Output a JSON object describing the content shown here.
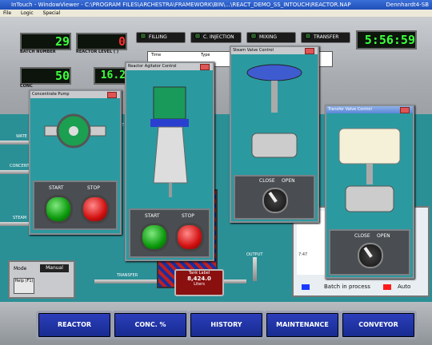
{
  "window": {
    "title": "InTouch - WindowViewer - C:\\PROGRAM FILES\\ARCHESTRA\\FRAMEWORK\\BIN\\...\\REACT_DEMO_SS_INTOUCH\\REACTOR.NAP",
    "right_text": "Dennhardt4-SB"
  },
  "menu": [
    "File",
    "Logic",
    "Special"
  ],
  "displays": {
    "batch_number": {
      "value": "29",
      "label": "BATCH NUMBER"
    },
    "reactor_level": {
      "value": "0",
      "label": "REACTOR LEVEL ( )"
    },
    "conc": {
      "value": "50",
      "label": "CONC"
    },
    "second": {
      "value": "16.2",
      "label": ""
    },
    "clock": "5:56:59"
  },
  "indicators": [
    "FILLING",
    "C. INJECTION",
    "MIXING",
    "TRANSFER"
  ],
  "alarm_headers": [
    "Time",
    "Type"
  ],
  "popups": {
    "concentrate_pump": {
      "title": "Concentrate Pump",
      "start": "START",
      "stop": "STOP"
    },
    "reactor_agitator": {
      "title": "Reactor Agitator Control",
      "start": "START",
      "stop": "STOP"
    },
    "steam_valve": {
      "title": "Steam Valve Control",
      "close": "CLOSE",
      "open": "OPEN"
    },
    "transfer_valve": {
      "title": "Transfer Valve Control",
      "close": "CLOSE",
      "open": "OPEN"
    }
  },
  "process": {
    "water_label": "WATE",
    "concent_label": "CONCENT",
    "steam_label": "STEAM",
    "act_label": "ACT",
    "transfer_label": "TRANSFER",
    "output_label": "OUTPUT",
    "tank_label": "Tank Label",
    "tank_value": "8,424.0",
    "tank_unit": "Liters"
  },
  "mode": {
    "label": "Mode",
    "value": "Manual",
    "help": "Help (F1)"
  },
  "trend": {
    "time_label": "7:47",
    "batch_legend": "Batch in process",
    "auto_legend": "Auto"
  },
  "nav": [
    "REACTOR",
    "CONC. %",
    "HISTORY",
    "MAINTENANCE",
    "CONVEYOR"
  ],
  "colors": {
    "panel_teal": "#2a9aa0",
    "nav_blue": "#1f33a8",
    "lcd_green": "#3cff3c",
    "stop_red": "#d21010",
    "start_green": "#0c9a0c"
  }
}
